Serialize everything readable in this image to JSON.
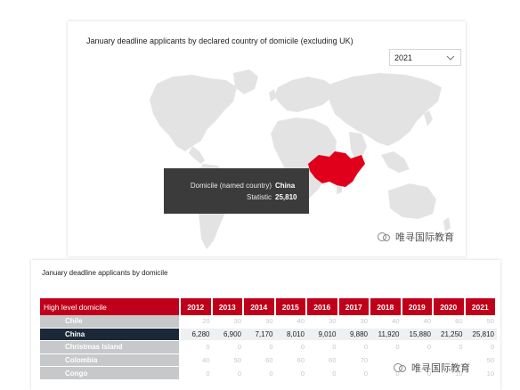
{
  "map_card": {
    "title": "January deadline applicants  by declared country of domicile (excluding UK)",
    "year_select": {
      "value": "2021",
      "icon": "chevron-down-icon"
    },
    "tooltip": {
      "domicile_label": "Domicile (named country)",
      "domicile_value": "China",
      "statistic_label": "Statistic",
      "statistic_value": "25,810"
    },
    "highlight_color": "#e0001b",
    "land_color": "#e3e3e3",
    "watermark": "唯寻国际教育"
  },
  "table_card": {
    "title": "January deadline applicants  by domicile",
    "header": {
      "domicile": "High level domicile",
      "years": [
        "2012",
        "2013",
        "2014",
        "2015",
        "2016",
        "2017",
        "2018",
        "2019",
        "2020",
        "2021"
      ]
    },
    "rows": [
      {
        "name": "Chile",
        "values": [
          "20",
          "30",
          "30",
          "40",
          "30",
          "30",
          "40",
          "40",
          "60",
          "50"
        ],
        "selected": false
      },
      {
        "name": "China",
        "values": [
          "6,280",
          "6,900",
          "7,170",
          "8,010",
          "9,010",
          "9,880",
          "11,920",
          "15,880",
          "21,250",
          "25,810"
        ],
        "selected": true
      },
      {
        "name": "Christmas Island",
        "values": [
          "0",
          "0",
          "0",
          "0",
          "0",
          "0",
          "0",
          "0",
          "0",
          "0"
        ],
        "selected": false
      },
      {
        "name": "Colombia",
        "values": [
          "40",
          "50",
          "60",
          "60",
          "60",
          "70",
          "",
          "",
          "",
          "50"
        ],
        "selected": false
      },
      {
        "name": "Congo",
        "values": [
          "0",
          "0",
          "0",
          "0",
          "0",
          "0",
          "0",
          "0",
          "10",
          "10"
        ],
        "selected": false
      }
    ],
    "header_color": "#c0001a",
    "selected_row_color": "#1b2838",
    "watermark": "唯寻国际教育"
  }
}
